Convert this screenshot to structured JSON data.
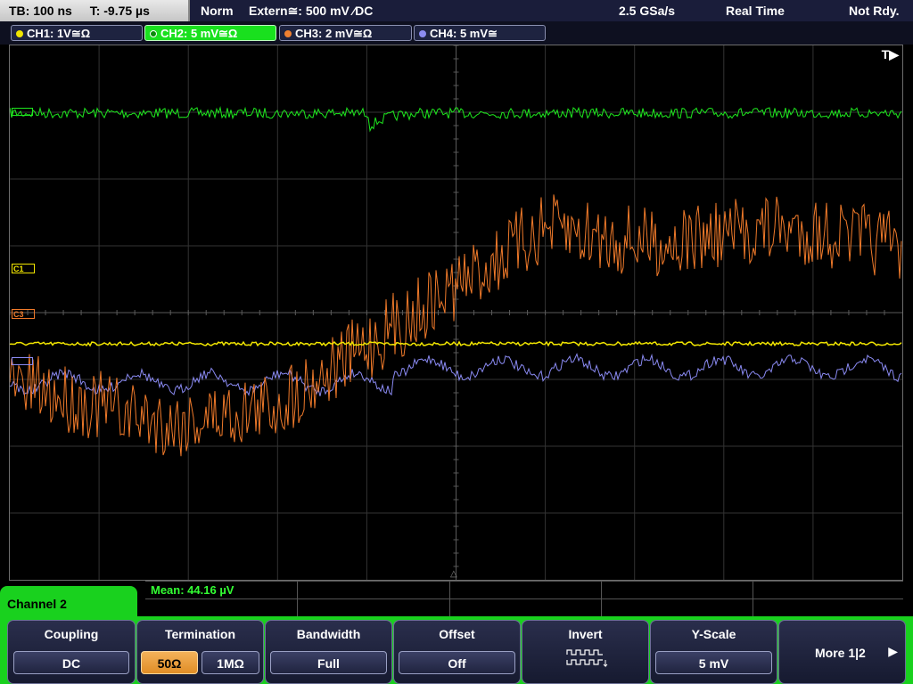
{
  "status": {
    "timebase": "TB: 100 ns",
    "trigger_pos": "T: -9.75 µs",
    "mode": "Norm",
    "trigger_source": "Extern≅: 500 mV ⁄DC",
    "sample_rate": "2.5 GSa/s",
    "acq_mode": "Real Time",
    "ready_state": "Not Rdy."
  },
  "channels": [
    {
      "label": "CH1: 1V≅Ω",
      "color": "#f2e600"
    },
    {
      "label": "CH2: 5 mV≅Ω",
      "color": "#1ee81e"
    },
    {
      "label": "CH3: 2 mV≅Ω",
      "color": "#f08030"
    },
    {
      "label": "CH4: 5 mV≅",
      "color": "#8c8cf0"
    }
  ],
  "markers": {
    "trigger": "T▶",
    "c1": "C1",
    "c3": "C3"
  },
  "measurement": {
    "mean": "Mean: 44.16 µV"
  },
  "panel_title": "Channel 2",
  "softkeys": {
    "coupling": {
      "title": "Coupling",
      "value": "DC"
    },
    "termination": {
      "title": "Termination",
      "opt1": "50Ω",
      "opt2": "1MΩ",
      "selected": "50Ω"
    },
    "bandwidth": {
      "title": "Bandwidth",
      "value": "Full"
    },
    "offset": {
      "title": "Offset",
      "value": "Off"
    },
    "invert": {
      "title": "Invert"
    },
    "yscale": {
      "title": "Y-Scale",
      "value": "5 mV"
    },
    "more": {
      "label": "More 1|2",
      "arrow": "▶"
    }
  },
  "colors": {
    "ch1": "#f2e600",
    "ch2": "#1ee81e",
    "ch3": "#f07a2a",
    "ch4": "#8a8af2",
    "active_panel": "#19d11e",
    "grid": "#3b3b3b"
  }
}
